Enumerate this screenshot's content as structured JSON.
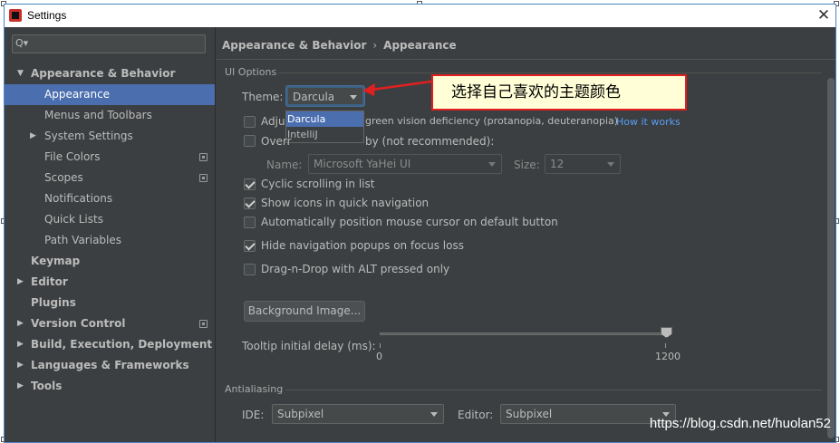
{
  "window": {
    "title": "Settings",
    "close_glyph": "✕"
  },
  "sidebar": {
    "search": {
      "icon": "search-icon",
      "glyph": "Q▾",
      "value": ""
    },
    "items": [
      {
        "label": "Appearance & Behavior",
        "level": 0,
        "arrow": "▼",
        "bold": true,
        "selected": false,
        "project_icon": false
      },
      {
        "label": "Appearance",
        "level": 1,
        "arrow": "",
        "bold": false,
        "selected": true,
        "project_icon": false
      },
      {
        "label": "Menus and Toolbars",
        "level": 1,
        "arrow": "",
        "bold": false,
        "selected": false,
        "project_icon": false
      },
      {
        "label": "System Settings",
        "level": 1,
        "arrow": "▶",
        "bold": false,
        "selected": false,
        "project_icon": false
      },
      {
        "label": "File Colors",
        "level": 1,
        "arrow": "",
        "bold": false,
        "selected": false,
        "project_icon": true
      },
      {
        "label": "Scopes",
        "level": 1,
        "arrow": "",
        "bold": false,
        "selected": false,
        "project_icon": true
      },
      {
        "label": "Notifications",
        "level": 1,
        "arrow": "",
        "bold": false,
        "selected": false,
        "project_icon": false
      },
      {
        "label": "Quick Lists",
        "level": 1,
        "arrow": "",
        "bold": false,
        "selected": false,
        "project_icon": false
      },
      {
        "label": "Path Variables",
        "level": 1,
        "arrow": "",
        "bold": false,
        "selected": false,
        "project_icon": false
      },
      {
        "label": "Keymap",
        "level": 0,
        "arrow": "",
        "bold": true,
        "selected": false,
        "project_icon": false
      },
      {
        "label": "Editor",
        "level": 0,
        "arrow": "▶",
        "bold": true,
        "selected": false,
        "project_icon": false
      },
      {
        "label": "Plugins",
        "level": 0,
        "arrow": "",
        "bold": true,
        "selected": false,
        "project_icon": false
      },
      {
        "label": "Version Control",
        "level": 0,
        "arrow": "▶",
        "bold": true,
        "selected": false,
        "project_icon": true
      },
      {
        "label": "Build, Execution, Deployment",
        "level": 0,
        "arrow": "▶",
        "bold": true,
        "selected": false,
        "project_icon": false
      },
      {
        "label": "Languages & Frameworks",
        "level": 0,
        "arrow": "▶",
        "bold": true,
        "selected": false,
        "project_icon": false
      },
      {
        "label": "Tools",
        "level": 0,
        "arrow": "▶",
        "bold": true,
        "selected": false,
        "project_icon": false
      }
    ]
  },
  "breadcrumb": {
    "parent": "Appearance & Behavior",
    "separator": "›",
    "current": "Appearance"
  },
  "ui_options": {
    "section_title": "UI Options",
    "theme": {
      "label": "Theme:",
      "value": "Darcula",
      "options": [
        "Darcula",
        "IntelliJ"
      ]
    },
    "adjust_colors": {
      "label_visible": "Adju",
      "label_rest": "green vision deficiency (protanopia, deuteranopia)",
      "checked": false,
      "link": "How it works"
    },
    "override_fonts": {
      "label_visible": "Overr",
      "label_rest": "by (not recommended):",
      "checked": false
    },
    "font_name": {
      "label": "Name:",
      "value": "Microsoft YaHei UI"
    },
    "font_size": {
      "label": "Size:",
      "value": "12"
    },
    "checkboxes": [
      {
        "label": "Cyclic scrolling in list",
        "checked": true
      },
      {
        "label": "Show icons in quick navigation",
        "checked": true
      },
      {
        "label": "Automatically position mouse cursor on default button",
        "checked": false
      },
      {
        "label": "Hide navigation popups on focus loss",
        "checked": true
      },
      {
        "label": "Drag-n-Drop with ALT pressed only",
        "checked": false
      }
    ],
    "background_button": "Background Image...",
    "tooltip": {
      "label": "Tooltip initial delay (ms):",
      "min": "0",
      "max": "1200",
      "value": 1200
    }
  },
  "antialiasing": {
    "section_title": "Antialiasing",
    "ide": {
      "label": "IDE:",
      "value": "Subpixel"
    },
    "editor": {
      "label": "Editor:",
      "value": "Subpixel"
    }
  },
  "annotation": {
    "text": "选择自己喜欢的主题颜色",
    "border_color": "#e02020",
    "background": "#fffed6"
  },
  "watermark": "https://blog.csdn.net/huolan52",
  "colors": {
    "panel": "#3c3f41",
    "selection": "#4b6eaf",
    "text": "#bbbbbb",
    "link": "#589df6"
  }
}
